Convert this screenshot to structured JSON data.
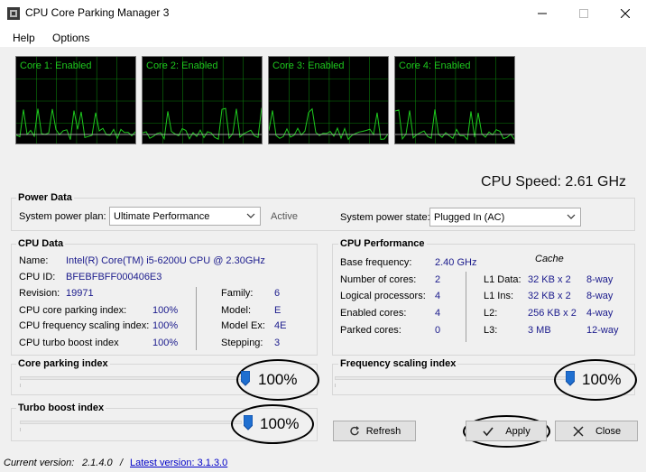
{
  "window": {
    "title": "CPU Core Parking Manager 3"
  },
  "menu": [
    "Help",
    "Options"
  ],
  "graphs": [
    {
      "label": "Core 1: Enabled"
    },
    {
      "label": "Core 2: Enabled"
    },
    {
      "label": "Core 3: Enabled"
    },
    {
      "label": "Core 4: Enabled"
    }
  ],
  "cpu_speed": "CPU Speed: 2.61 GHz",
  "power": {
    "title": "Power Data",
    "plan_label": "System power plan:",
    "plan_value": "Ultimate Performance",
    "plan_status": "Active",
    "state_label": "System power state:",
    "state_value": "Plugged In (AC)"
  },
  "cpu_data": {
    "title": "CPU Data",
    "name_label": "Name:",
    "name_value": "Intel(R) Core(TM) i5-6200U CPU @ 2.30GHz",
    "id_label": "CPU ID:",
    "id_value": "BFEBFBFF000406E3",
    "revision_label": "Revision:",
    "revision_value": "19971",
    "parking_label": "CPU core parking index:",
    "parking_value": "100%",
    "freq_label": "CPU frequency scaling index:",
    "freq_value": "100%",
    "turbo_label": "CPU turbo boost index",
    "turbo_value": "100%",
    "family_label": "Family:",
    "family_value": "6",
    "model_label": "Model:",
    "model_value": "E",
    "modelex_label": "Model Ex:",
    "modelex_value": "4E",
    "stepping_label": "Stepping:",
    "stepping_value": "3"
  },
  "cpu_perf": {
    "title": "CPU Performance",
    "cache_label": "Cache",
    "base_label": "Base frequency:",
    "base_value": "2.40 GHz",
    "cores_label": "Number of cores:",
    "cores_value": "2",
    "logical_label": "Logical processors:",
    "logical_value": "4",
    "enabled_label": "Enabled cores:",
    "enabled_value": "4",
    "parked_label": "Parked cores:",
    "parked_value": "0",
    "l1d_label": "L1 Data:",
    "l1d_size": "32 KB x 2",
    "l1d_way": "8-way",
    "l1i_label": "L1 Ins:",
    "l1i_size": "32 KB x 2",
    "l1i_way": "8-way",
    "l2_label": "L2:",
    "l2_size": "256 KB x 2",
    "l2_way": "4-way",
    "l3_label": "L3:",
    "l3_size": "3 MB",
    "l3_way": "12-way"
  },
  "sliders": {
    "parking_title": "Core parking index",
    "parking_value": "100%",
    "parking_level": 1.0,
    "freq_title": "Frequency scaling index",
    "freq_value": "100%",
    "freq_level": 1.0,
    "turbo_title": "Turbo boost index",
    "turbo_value": "100%",
    "turbo_level": 1.0
  },
  "buttons": {
    "refresh": "Refresh",
    "apply": "Apply",
    "close": "Close"
  },
  "status": {
    "current_label": "Current version:",
    "current_value": "2.1.4.0",
    "divider": "/",
    "latest_link": "Latest version: 3.1.3.0"
  },
  "colors": {
    "graph_bg": "#000000",
    "graph_line": "#1ec81e",
    "graph_grid": "#0a7a0a",
    "value_text": "#1a1a8c",
    "thumb": "#1f6fd0"
  }
}
